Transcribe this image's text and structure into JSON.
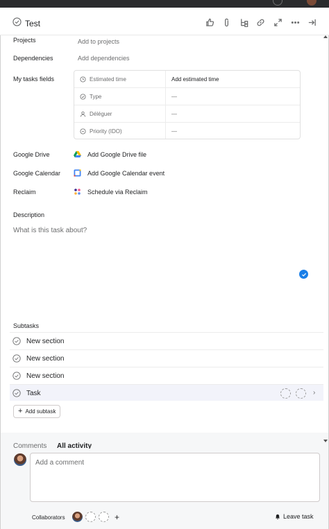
{
  "header": {
    "title": "Test",
    "tools": [
      "like-icon",
      "attachment-icon",
      "subtask-icon",
      "link-icon",
      "expand-icon",
      "more-icon",
      "close-panel-icon"
    ]
  },
  "fields": {
    "projects": {
      "label": "Projects",
      "value": "Add to projects"
    },
    "dependencies": {
      "label": "Dependencies",
      "value": "Add dependencies"
    },
    "my_tasks_fields": {
      "label": "My tasks fields",
      "rows": [
        {
          "label": "Estimated time",
          "value": "Add estimated time",
          "icon": "clock-icon"
        },
        {
          "label": "Type",
          "value": "—",
          "icon": "type-icon"
        },
        {
          "label": "Déléguer",
          "value": "—",
          "icon": "person-icon"
        },
        {
          "label": "Priority (IDO)",
          "value": "—",
          "icon": "priority-icon"
        }
      ]
    },
    "google_drive": {
      "label": "Google Drive",
      "value": "Add Google Drive file"
    },
    "google_calendar": {
      "label": "Google Calendar",
      "value": "Add Google Calendar event"
    },
    "reclaim": {
      "label": "Reclaim",
      "value": "Schedule via Reclaim"
    }
  },
  "description": {
    "label": "Description",
    "placeholder": "What is this task about?"
  },
  "subtasks": {
    "label": "Subtasks",
    "items": [
      {
        "text": "New section"
      },
      {
        "text": "New section"
      },
      {
        "text": "New section"
      },
      {
        "text": "Task"
      }
    ],
    "add_label": "Add subtask"
  },
  "activity": {
    "tabs": [
      {
        "label": "Comments"
      },
      {
        "label": "All activity"
      }
    ]
  },
  "comment": {
    "placeholder": "Add a comment"
  },
  "footer": {
    "collaborators_label": "Collaborators",
    "leave_label": "Leave task"
  },
  "colors": {
    "accent_blue": "#1a7fe8",
    "text": "#1e1f21",
    "muted": "#6d6e6f",
    "highlight_row": "#f2f3fa"
  }
}
